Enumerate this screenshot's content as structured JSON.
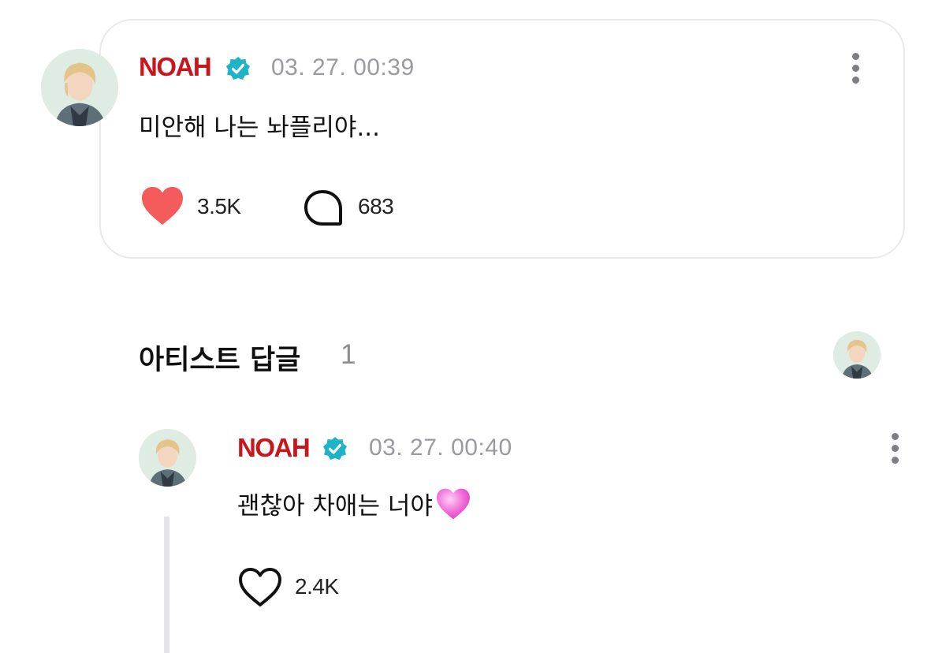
{
  "post": {
    "author": "NOAH",
    "timestamp": "03. 27. 00:39",
    "text": "미안해 나는 놔플리야...",
    "likes": "3.5K",
    "comments": "683"
  },
  "artist_replies": {
    "title": "아티스트 답글",
    "count": "1"
  },
  "reply": {
    "author": "NOAH",
    "timestamp": "03. 27. 00:40",
    "text": "괜찮아 차애는 너야",
    "emoji": "💗",
    "likes": "2.4K"
  },
  "colors": {
    "name_red": "#c8161d",
    "verified_teal": "#1fb3c8",
    "heart_red": "#f45b5b",
    "reply_emoji_pink": "#f06bd8"
  },
  "icons": {
    "liked_heart": "heart-filled-icon",
    "comment": "comment-bubble-icon",
    "reply_heart": "heart-outline-icon",
    "more": "more-vertical-icon",
    "verified": "verified-badge-icon"
  }
}
